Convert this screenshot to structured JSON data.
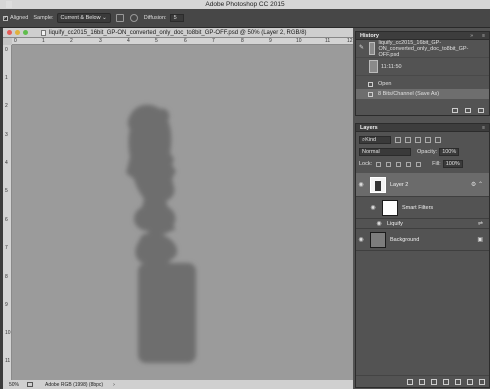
{
  "app": {
    "title": "Adobe Photoshop CC 2015"
  },
  "options": {
    "aligned_label": "Aligned",
    "aligned_checked": "✓",
    "sample_label": "Sample:",
    "sample_value": "Current & Below",
    "diffusion_label": "Diffusion:",
    "diffusion_value": "5"
  },
  "document": {
    "title": "liquify_cc2015_16bit_GP-ON_converted_only_doc_to8bit_GP-OFF.psd @ 50% (Layer 2, RGB/8)",
    "ruler_h": [
      "0",
      "1",
      "2",
      "3",
      "4",
      "5",
      "6",
      "7",
      "8",
      "9",
      "10",
      "11",
      "12"
    ],
    "ruler_v": [
      "0",
      "1",
      "2",
      "3",
      "4",
      "5",
      "6",
      "7",
      "8",
      "9",
      "10",
      "11"
    ],
    "status_zoom": "50%",
    "status_profile": "Adobe RGB (1998) (8bpc)",
    "status_arrow": "›"
  },
  "history": {
    "title": "History",
    "menu": "≡",
    "collapse": "»",
    "snapshots": [
      {
        "label": "liquify_cc2015_16bit_GP-ON_converted_only_doc_to8bit_GP-OFF.psd"
      },
      {
        "label": "11:11:50"
      }
    ],
    "steps": [
      {
        "label": "Open",
        "selected": false
      },
      {
        "label": "8 Bits/Channel (Save As)",
        "selected": true
      }
    ]
  },
  "layers": {
    "title": "Layers",
    "menu": "≡",
    "kind_label": "Kind",
    "blend_mode": "Normal",
    "opacity_label": "Opacity:",
    "opacity_value": "100%",
    "lock_label": "Lock:",
    "fill_label": "Fill:",
    "fill_value": "100%",
    "items": [
      {
        "name": "Layer 2",
        "visible": true,
        "active": true
      },
      {
        "name": "Smart Filters",
        "visible": true
      },
      {
        "name": "Liquify",
        "visible": true
      },
      {
        "name": "Background",
        "visible": true,
        "locked": true
      }
    ]
  }
}
